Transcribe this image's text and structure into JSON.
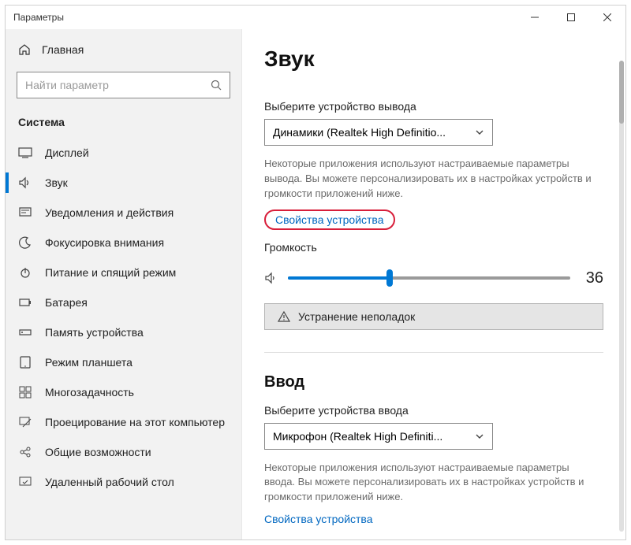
{
  "window": {
    "title": "Параметры"
  },
  "sidebar": {
    "home": "Главная",
    "search_placeholder": "Найти параметр",
    "section": "Система",
    "items": [
      {
        "label": "Дисплей"
      },
      {
        "label": "Звук"
      },
      {
        "label": "Уведомления и действия"
      },
      {
        "label": "Фокусировка внимания"
      },
      {
        "label": "Питание и спящий режим"
      },
      {
        "label": "Батарея"
      },
      {
        "label": "Память устройства"
      },
      {
        "label": "Режим планшета"
      },
      {
        "label": "Многозадачность"
      },
      {
        "label": "Проецирование на этот компьютер"
      },
      {
        "label": "Общие возможности"
      },
      {
        "label": "Удаленный рабочий стол"
      }
    ]
  },
  "main": {
    "title": "Звук",
    "output": {
      "label": "Выберите устройство вывода",
      "selected": "Динамики (Realtek High Definitio...",
      "desc": "Некоторые приложения используют настраиваемые параметры вывода. Вы можете персонализировать их в настройках устройств и громкости приложений ниже.",
      "link": "Свойства устройства",
      "volume_label": "Громкость",
      "volume_value": "36",
      "troubleshoot": "Устранение неполадок"
    },
    "input": {
      "heading": "Ввод",
      "label": "Выберите устройства ввода",
      "selected": "Микрофон (Realtek High Definiti...",
      "desc": "Некоторые приложения используют настраиваемые параметры ввода. Вы можете персонализировать их в настройках устройств и громкости приложений ниже.",
      "link": "Свойства устройства"
    }
  }
}
